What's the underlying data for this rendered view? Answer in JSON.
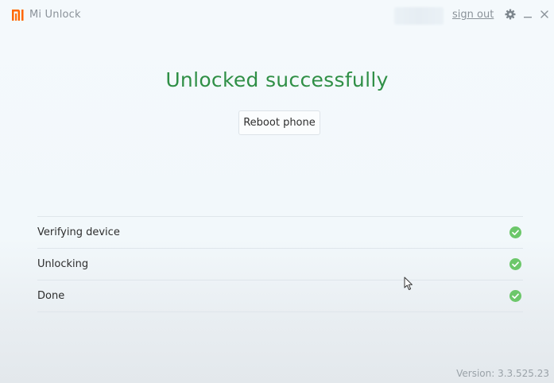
{
  "titlebar": {
    "app_title": "Mi Unlock",
    "sign_out_label": "sign out",
    "icons": [
      "mi-logo-icon",
      "gear-icon",
      "minimize-icon",
      "close-icon"
    ]
  },
  "main": {
    "headline": "Unlocked successfully",
    "reboot_label": "Reboot phone"
  },
  "steps": [
    {
      "label": "Verifying device",
      "status": "complete"
    },
    {
      "label": "Unlocking",
      "status": "complete"
    },
    {
      "label": "Done",
      "status": "complete"
    }
  ],
  "footer": {
    "version": "Version: 3.3.525.23"
  },
  "colors": {
    "brand": "#ff6700",
    "success_text": "#2f8f46",
    "check_fill": "#6cc76a"
  }
}
